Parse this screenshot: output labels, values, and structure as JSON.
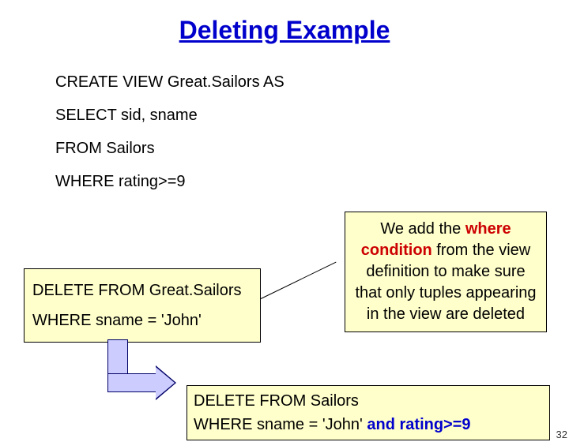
{
  "title": "Deleting Example",
  "sql": {
    "line1": "CREATE VIEW Great.Sailors AS",
    "line2": "SELECT sid, sname",
    "line3": "FROM Sailors",
    "line4": "WHERE rating>=9"
  },
  "deleteBox": {
    "line1": "DELETE FROM Great.Sailors",
    "line2": "WHERE sname = 'John'"
  },
  "explain": {
    "part1": "We add the ",
    "highlight": "where condition",
    "part2": " from the view definition to make sure that only tuples appearing in the view are deleted"
  },
  "result": {
    "line1": "DELETE FROM Sailors",
    "line2a": "WHERE sname = 'John' ",
    "line2b": "and rating>=9"
  },
  "pageNum": "32"
}
